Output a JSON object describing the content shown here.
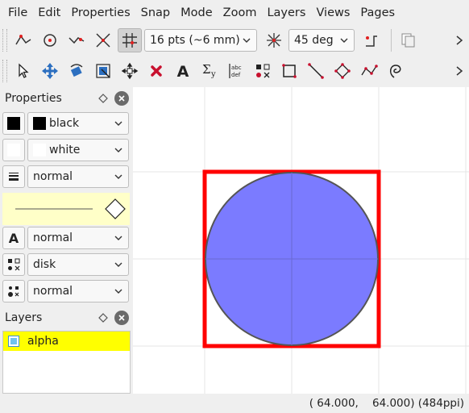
{
  "menu": [
    "File",
    "Edit",
    "Properties",
    "Snap",
    "Mode",
    "Zoom",
    "Layers",
    "Views",
    "Pages"
  ],
  "toolbar1": {
    "snap_icons": [
      "snap-vertex-icon",
      "snap-center-icon",
      "snap-boundary-icon",
      "snap-intersection-icon",
      "snap-grid-icon"
    ],
    "grid_size": "16 pts (~6 mm)",
    "angle_icon": "snap-angle-icon",
    "angle": "45 deg",
    "autosnap_icon": "snap-auto-icon",
    "pages_icon": "copy-pages-icon"
  },
  "toolbar2": {
    "tools": [
      "select-tool-icon",
      "translate-tool-icon",
      "rotate-tool-icon",
      "stretch-tool-icon",
      "pan-tool-icon",
      "shred-tool-icon",
      "text-label-tool-icon",
      "math-symbol-tool-icon",
      "paragraph-tool-icon",
      "mark-tool-icon",
      "rectangle-tool-icon",
      "line-tool-icon",
      "arc-tool-icon",
      "polyline-tool-icon",
      "spline-tool-icon"
    ]
  },
  "properties": {
    "title": "Properties",
    "stroke": {
      "label": "black",
      "color": "#000000"
    },
    "fill": {
      "label": "white",
      "color": "#ffffff"
    },
    "pen": "normal",
    "textsize": "normal",
    "marker": "disk",
    "markersize": "normal"
  },
  "layers": {
    "title": "Layers",
    "items": [
      {
        "name": "alpha",
        "active": true,
        "visible": true
      }
    ]
  },
  "canvas": {
    "shapes": [
      {
        "type": "square",
        "stroke": "#ff0000"
      },
      {
        "type": "circle",
        "fill": "#7b7bff",
        "stroke": "#555555"
      }
    ]
  },
  "status": {
    "coords": "( 64.000,    64.000) (484ppi)"
  }
}
